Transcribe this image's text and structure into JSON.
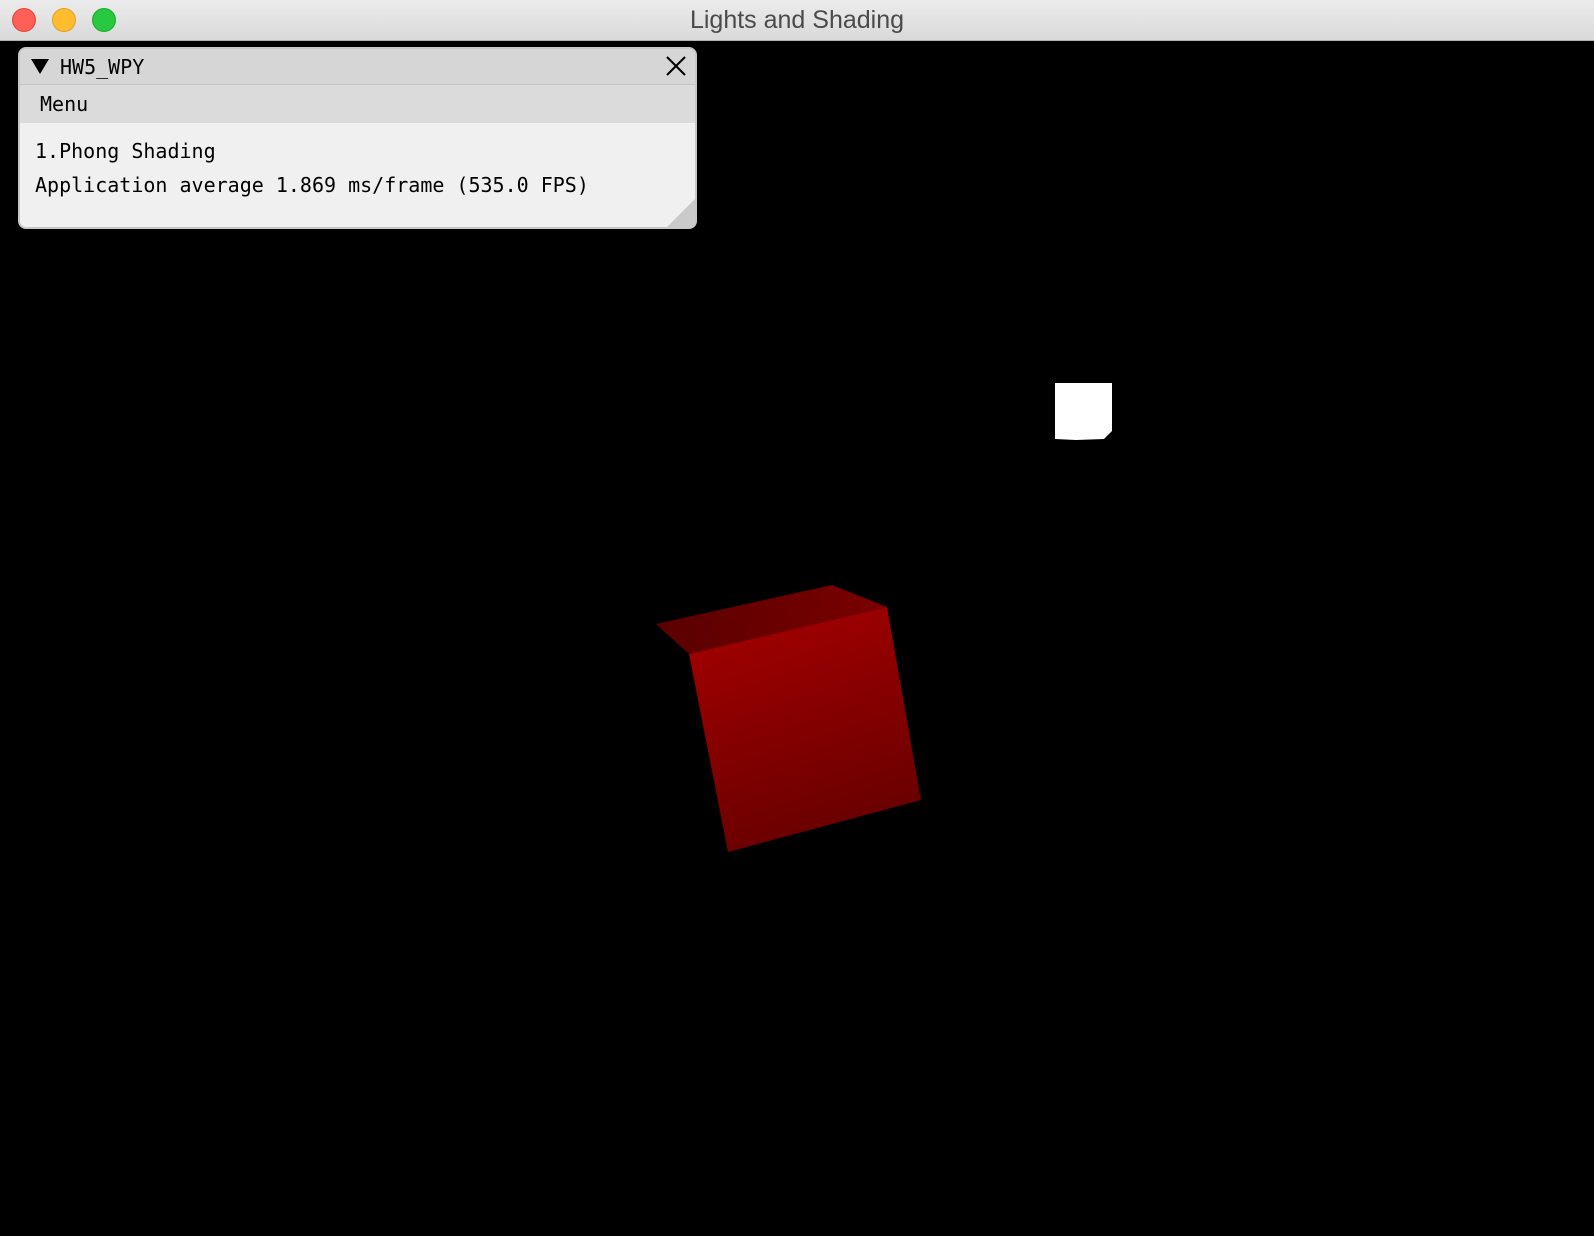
{
  "window": {
    "title": "Lights and Shading",
    "controls": [
      "close-button",
      "minimize-button",
      "zoom-button"
    ]
  },
  "imgui_window": {
    "title": "HW5_WPY",
    "menu": [
      "Menu"
    ],
    "lines": [
      "1.Phong Shading",
      "Application average 1.869 ms/frame (535.0 FPS)"
    ]
  },
  "scene": {
    "background": "#000000",
    "objects": [
      {
        "name": "light-cube",
        "color": "#ffffff"
      },
      {
        "name": "lit-cube",
        "color": "#a30000"
      }
    ]
  }
}
